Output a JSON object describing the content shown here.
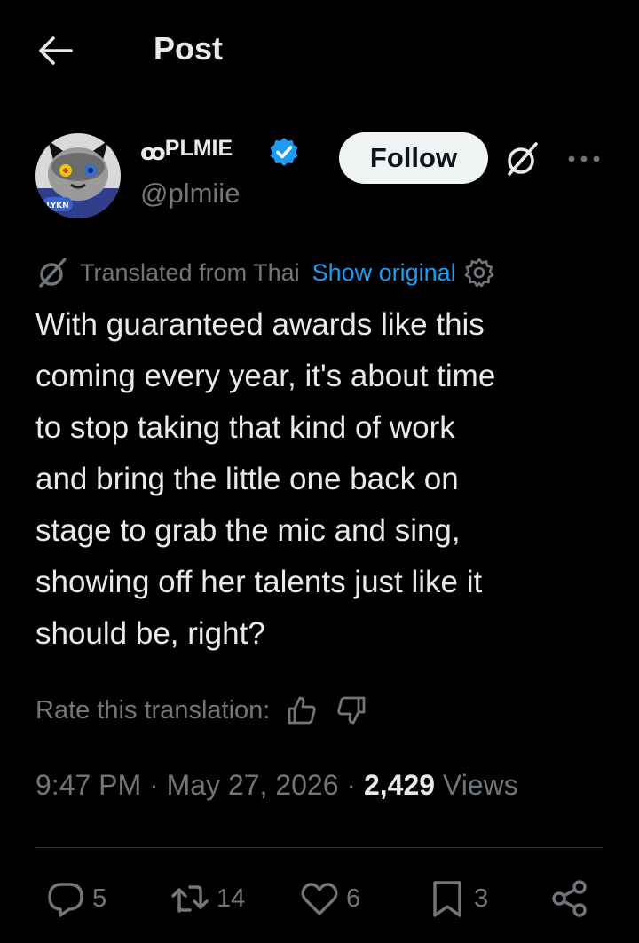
{
  "header": {
    "title": "Post"
  },
  "author": {
    "name_prefix": "ꝏ",
    "display_name": "PLMIE",
    "handle": "@plmiie",
    "verified": true,
    "avatar_badge": "LYKN",
    "follow_label": "Follow"
  },
  "translation": {
    "label": "Translated from Thai",
    "show_original": "Show original"
  },
  "post": {
    "text": "With guaranteed awards like this\ncoming every year, it's about time\nto stop taking that kind of work\nand bring the little one back on\nstage to grab the mic and sing,\nshowing off her talents just like it\nshould be, right?"
  },
  "rate": {
    "label": "Rate this translation:"
  },
  "meta": {
    "time": "9:47 PM",
    "separator": " · ",
    "date": "May 27, 2026",
    "views_count": "2,429",
    "views_label": " Views"
  },
  "actions": {
    "replies": "5",
    "reposts": "14",
    "likes": "6",
    "bookmarks": "3"
  },
  "colors": {
    "background": "#000000",
    "text": "#e7e9ea",
    "muted": "#71767b",
    "link": "#1d9bf0",
    "verified": "#1d9bf0",
    "follow_bg": "#eff3f4",
    "divider": "#2f3336"
  },
  "icons": {
    "back": "arrow-left-icon",
    "verified": "verified-badge-icon",
    "grok": "grok-icon",
    "more": "more-horizontal-icon",
    "translate": "grok-icon",
    "settings": "gear-icon",
    "thumb_up": "thumbs-up-icon",
    "thumb_down": "thumbs-down-icon",
    "reply": "reply-icon",
    "repost": "repost-icon",
    "like": "heart-icon",
    "bookmark": "bookmark-icon",
    "share": "share-icon"
  }
}
